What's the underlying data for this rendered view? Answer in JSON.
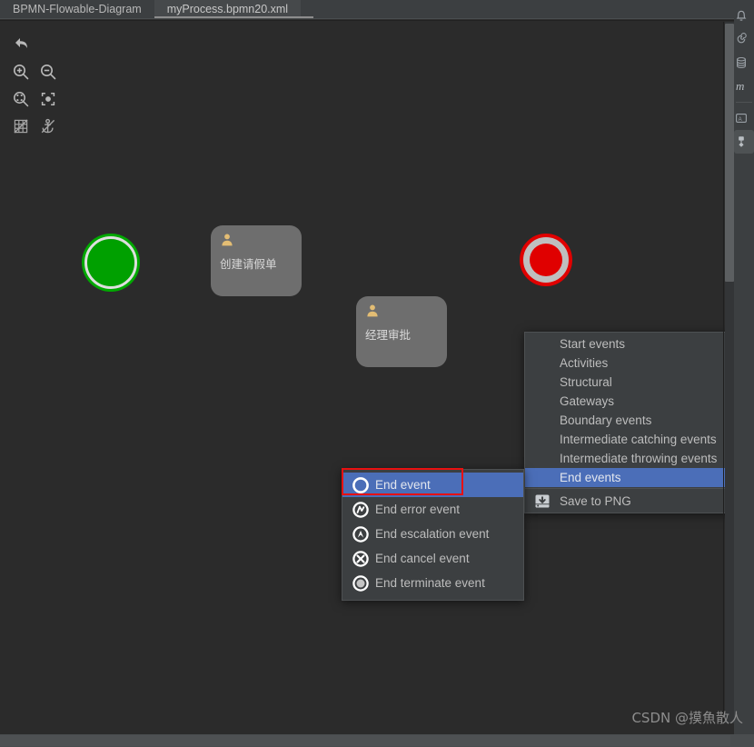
{
  "tabs": [
    {
      "label": "BPMN-Flowable-Diagram",
      "active": false
    },
    {
      "label": "myProcess.bpmn20.xml",
      "active": true
    }
  ],
  "toolbar": {
    "items": [
      {
        "name": "undo-icon",
        "tooltip": "Undo"
      },
      {
        "name": "zoom-in-icon",
        "tooltip": "Zoom in"
      },
      {
        "name": "zoom-out-icon",
        "tooltip": "Zoom out"
      },
      {
        "name": "zoom-fit-icon",
        "tooltip": "Zoom to fit"
      },
      {
        "name": "zoom-actual-icon",
        "tooltip": "Actual size"
      },
      {
        "name": "grid-off-icon",
        "tooltip": "Toggle grid"
      },
      {
        "name": "anchor-off-icon",
        "tooltip": "Toggle snap"
      }
    ]
  },
  "diagram": {
    "start_event": {
      "name": "start-event",
      "fill": "#00a000",
      "ring": "#dedede"
    },
    "tasks": [
      {
        "label": "创建请假单",
        "icon": "user-task-icon",
        "fill": "#6e6e6e"
      },
      {
        "label": "经理审批",
        "icon": "user-task-icon",
        "fill": "#6e6e6e"
      }
    ],
    "end_event": {
      "name": "end-event",
      "fill": "#e00000",
      "ring": "#bfbfbf"
    }
  },
  "context_menu": {
    "items": [
      {
        "label": "Start events",
        "has_submenu": true,
        "highlight": false
      },
      {
        "label": "Activities",
        "has_submenu": true,
        "highlight": false
      },
      {
        "label": "Structural",
        "has_submenu": true,
        "highlight": false
      },
      {
        "label": "Gateways",
        "has_submenu": true,
        "highlight": false
      },
      {
        "label": "Boundary events",
        "has_submenu": true,
        "highlight": false
      },
      {
        "label": "Intermediate catching events",
        "has_submenu": true,
        "highlight": false
      },
      {
        "label": "Intermediate throwing events",
        "has_submenu": true,
        "highlight": false
      },
      {
        "label": "End events",
        "has_submenu": true,
        "highlight": true
      }
    ],
    "save_item": {
      "label": "Save to PNG",
      "icon": "save-disk-icon"
    },
    "arrow_glyph": "›",
    "highlight_color": "#4b6eb8",
    "background": "#3c3f41"
  },
  "submenu": {
    "items": [
      {
        "label": "End event",
        "icon": "end-event-icon",
        "highlight": true
      },
      {
        "label": "End error event",
        "icon": "end-error-event-icon",
        "highlight": false
      },
      {
        "label": "End escalation event",
        "icon": "end-escalation-event-icon",
        "highlight": false
      },
      {
        "label": "End cancel event",
        "icon": "end-cancel-event-icon",
        "highlight": false
      },
      {
        "label": "End terminate event",
        "icon": "end-terminate-event-icon",
        "highlight": false
      }
    ],
    "annotation_color": "#e81010"
  },
  "right_sidebar": {
    "items": [
      {
        "name": "bell-icon"
      },
      {
        "name": "spiral-icon"
      },
      {
        "name": "database-icon"
      },
      {
        "name": "maven-icon"
      },
      {
        "name": "ascii-icon"
      },
      {
        "name": "structure-icon",
        "selected": true
      }
    ]
  },
  "watermark": {
    "text": "CSDN @摸魚散人"
  }
}
